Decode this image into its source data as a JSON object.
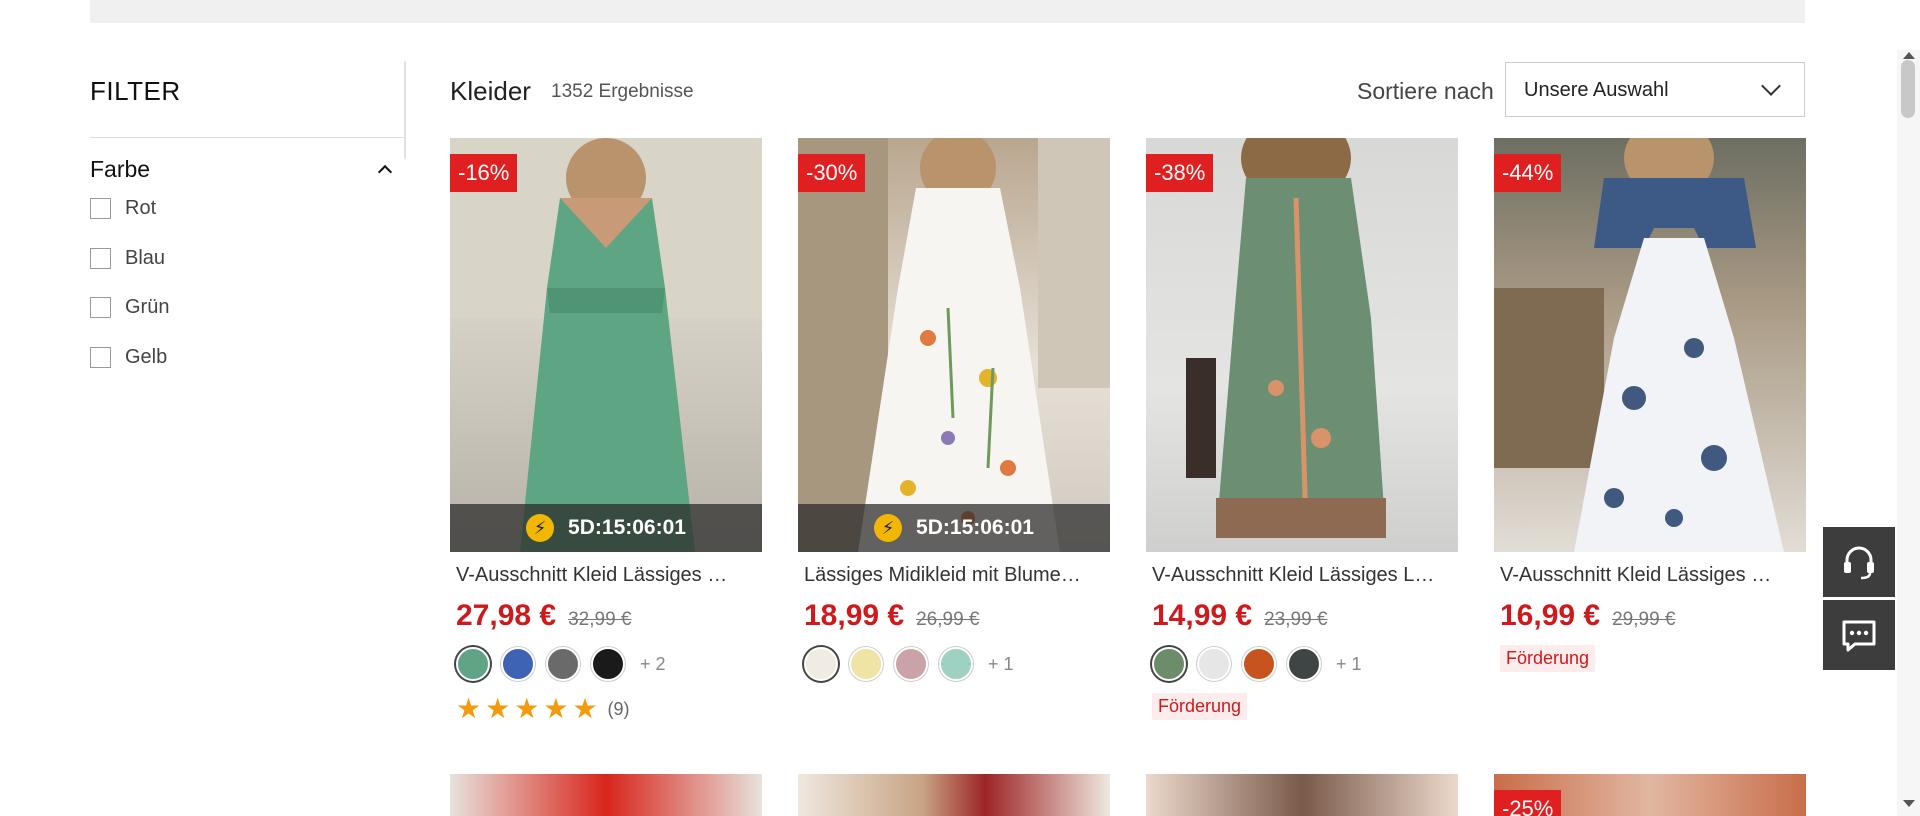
{
  "filter": {
    "title": "FILTER",
    "group_title": "Farbe",
    "options": [
      "Rot",
      "Blau",
      "Grün",
      "Gelb"
    ]
  },
  "header": {
    "category": "Kleider",
    "count": "1352 Ergebnisse",
    "sort_label": "Sortiere nach",
    "sort_value": "Unsere Auswahl"
  },
  "products": [
    {
      "badge": "-16%",
      "timer": "5D:15:06:01",
      "name": "V-Ausschnitt Kleid Lässiges …",
      "price": "27,98 €",
      "old_price": "32,99 €",
      "swatch_colors": [
        "#5fa585",
        "#3e63b4",
        "#6a6a6a",
        "#1a1a1a"
      ],
      "more": "+ 2",
      "rating_count": "(9)"
    },
    {
      "badge": "-30%",
      "timer": "5D:15:06:01",
      "name": "Lässiges Midikleid mit Blume…",
      "price": "18,99 €",
      "old_price": "26,99 €",
      "swatch_colors": [
        "#f0ebe3",
        "#efe3a6",
        "#c9a3a8",
        "#9ed1c2"
      ],
      "more": "+ 1"
    },
    {
      "badge": "-38%",
      "name": "V-Ausschnitt Kleid Lässiges L…",
      "price": "14,99 €",
      "old_price": "23,99 €",
      "swatch_colors": [
        "#6c8c6a",
        "#e6e6e6",
        "#c7541f",
        "#3f4444"
      ],
      "more": "+ 1",
      "promo": "Förderung"
    },
    {
      "badge": "-44%",
      "name": "V-Ausschnitt Kleid Lässiges …",
      "price": "16,99 €",
      "old_price": "29,99 €",
      "promo": "Förderung"
    }
  ],
  "row2_badge": "-25%",
  "icons": {
    "support": "headset-icon",
    "chat": "chat-icon",
    "bolt": "lightning-icon",
    "star": "star-icon"
  },
  "colors": {
    "price": "#d0191d",
    "badge": "#e02020",
    "star": "#f39a0d"
  }
}
